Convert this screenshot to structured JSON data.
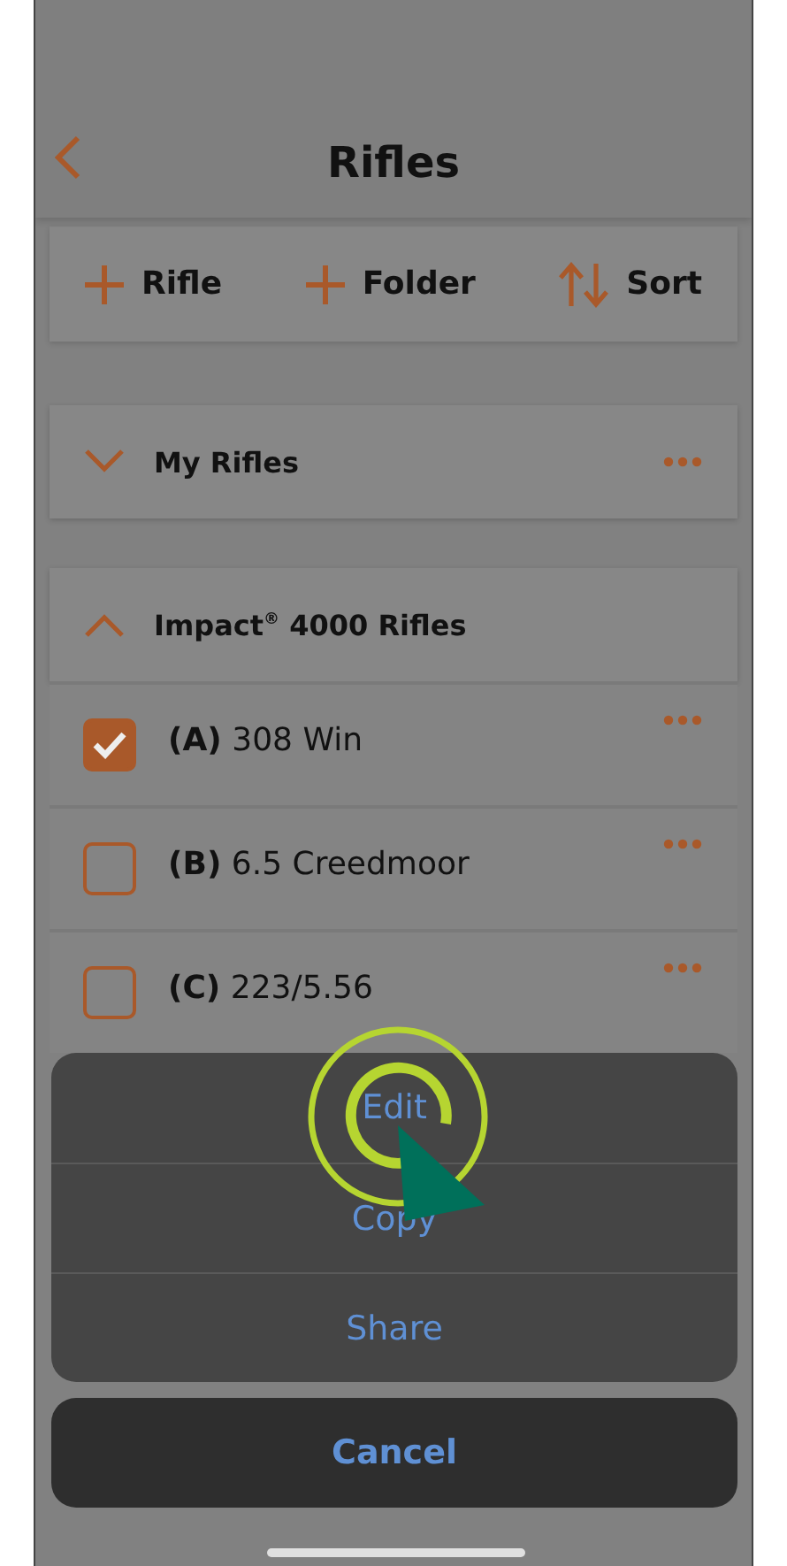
{
  "header": {
    "title": "Rifles"
  },
  "toolbar": [
    {
      "kind": "add",
      "label": "Rifle"
    },
    {
      "kind": "add",
      "label": "Folder"
    },
    {
      "kind": "sort",
      "label": "Sort"
    }
  ],
  "folders": [
    {
      "name": "My Rifles",
      "expanded": false
    },
    {
      "name": "Impact$^{®}$ 4000 Rifles",
      "expanded": true,
      "rifles": [
        {
          "code": "(A)",
          "name": "308 Win",
          "checked": true
        },
        {
          "code": "(B)",
          "name": "6.5 Creedmoor",
          "checked": false
        },
        {
          "code": "(C)",
          "name": "223/5.56",
          "checked": false
        }
      ]
    }
  ],
  "action_sheet": {
    "actions": [
      "Edit",
      "Copy",
      "Share"
    ],
    "cancel": "Cancel"
  }
}
